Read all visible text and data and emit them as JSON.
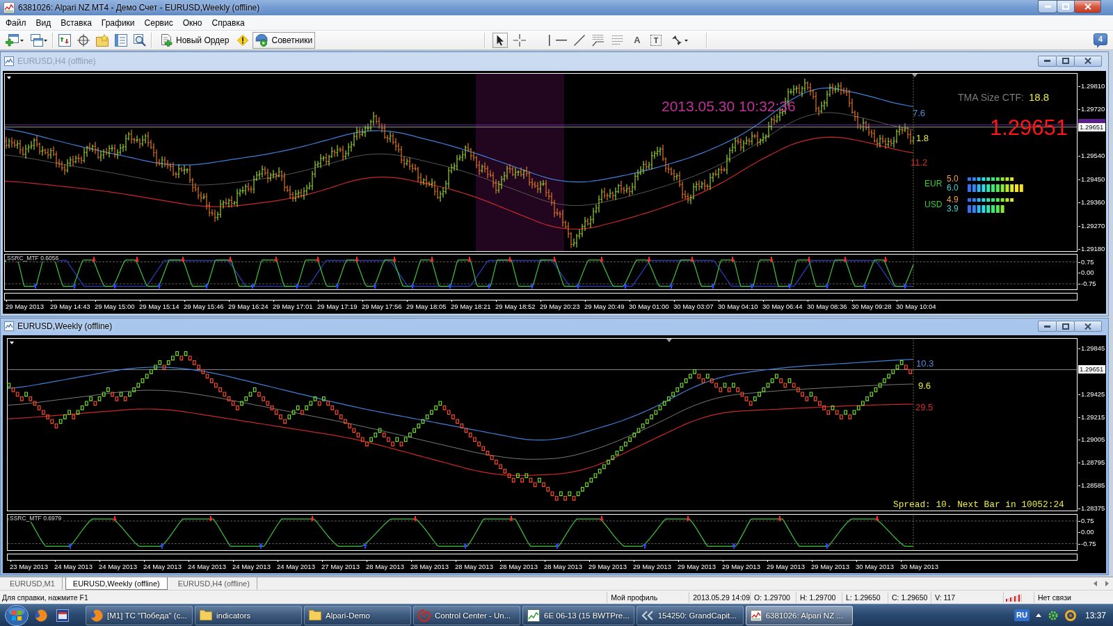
{
  "window": {
    "title": "6381026: Alpari NZ MT4 - Демо Счет - EURUSD,Weekly (offline)"
  },
  "menu": [
    "Файл",
    "Вид",
    "Вставка",
    "Графики",
    "Сервис",
    "Окно",
    "Справка"
  ],
  "toolbar": {
    "new_order": "Новый Ордер",
    "experts": {
      "label": "Советники",
      "selected": true
    },
    "cursor_tool": {
      "selected": true
    },
    "text_tool": "A",
    "label_tool": "T",
    "messages": "4"
  },
  "charts": [
    {
      "kind": "bars",
      "title": "EURUSD,H4 (offline)",
      "active": false,
      "server_time": "2013.05.30 10:32:36",
      "tma_size": {
        "label": "TMA Size CTF:",
        "value": "18.8"
      },
      "big_price": "1.29651",
      "band_labels": {
        "upper": "7.6",
        "middle": "1.8",
        "lower": "11.2"
      },
      "currency_strength": [
        {
          "currency": "EUR",
          "rows": [
            {
              "reading": "5.0"
            },
            {
              "reading": "6.0"
            }
          ]
        },
        {
          "currency": "USD",
          "rows": [
            {
              "reading": "4.9"
            },
            {
              "reading": "3.9"
            }
          ]
        }
      ],
      "price_axis": [
        "1.29810",
        "1.29720",
        "1.29540",
        "1.29450",
        "1.29360",
        "1.29270",
        "1.29180"
      ],
      "current_price": "1.29651",
      "indicator": {
        "label": "SSRC_MTF 0.6056",
        "axis": [
          "0.75",
          "0.00",
          "-0.75"
        ]
      },
      "time_axis": [
        "29 May 2013",
        "29 May 14:43",
        "29 May 15:00",
        "29 May 15:14",
        "29 May 15:46",
        "29 May 16:24",
        "29 May 17:01",
        "29 May 17:19",
        "29 May 17:56",
        "29 May 18:05",
        "29 May 18:21",
        "29 May 18:52",
        "29 May 20:23",
        "29 May 20:49",
        "30 May 01:00",
        "30 May 03:07",
        "30 May 04:10",
        "30 May 06:44",
        "30 May 08:36",
        "30 May 09:28",
        "30 May 10:04"
      ]
    },
    {
      "kind": "renko",
      "title": "EURUSD,Weekly (offline)",
      "active": true,
      "band_labels": {
        "upper": "10.3",
        "middle": "9.6",
        "lower": "29.5"
      },
      "spread_info": "Spread: 10. Next Bar in 10052:24",
      "price_axis": [
        "1.29845",
        "1.29425",
        "1.29215",
        "1.29005",
        "1.28795",
        "1.28585",
        "1.28375"
      ],
      "current_price": "1.29651",
      "indicator": {
        "label": "SSRC_MTF 0.6979",
        "axis": [
          "0.75",
          "0.00",
          "-0.75"
        ]
      },
      "time_axis": [
        "23 May 2013",
        "24 May 2013",
        "24 May 2013",
        "24 May 2013",
        "24 May 2013",
        "24 May 2013",
        "24 May 2013",
        "27 May 2013",
        "28 May 2013",
        "28 May 2013",
        "28 May 2013",
        "28 May 2013",
        "28 May 2013",
        "29 May 2013",
        "29 May 2013",
        "29 May 2013",
        "29 May 2013",
        "29 May 2013",
        "29 May 2013",
        "30 May 2013",
        "30 May 2013"
      ]
    }
  ],
  "tabs": [
    {
      "label": "EURUSD,M1",
      "selected": false
    },
    {
      "label": "EURUSD,Weekly (offline)",
      "selected": true
    },
    {
      "label": "EURUSD,H4 (offline)",
      "selected": false
    }
  ],
  "status_bar": {
    "help": "Для справки, нажмите F1",
    "profile": "Мой профиль",
    "time": "2013.05.29 14:09",
    "open": "O: 1.29700",
    "high": "H: 1.29700",
    "low": "L: 1.29650",
    "close": "C: 1.29650",
    "volume": "V: 117",
    "connection": "Нет связи"
  },
  "taskbar": {
    "tasks": [
      {
        "kind": "browser",
        "label": "[M1] ТС \"Победа\" (с...",
        "selected": false
      },
      {
        "kind": "folder",
        "label": "indicators",
        "selected": false
      },
      {
        "kind": "folder",
        "label": "Alpari-Demo",
        "selected": false
      },
      {
        "kind": "remote",
        "label": "Control Center - Un...",
        "selected": false
      },
      {
        "kind": "chart",
        "label": "6E 06-13 (15 BWTPre...",
        "selected": false
      },
      {
        "kind": "exchange",
        "label": "154250: GrandCapit...",
        "selected": false
      },
      {
        "kind": "terminal",
        "label": "6381026: Alpari NZ ...",
        "selected": true
      }
    ],
    "language": "RU",
    "clock": "13:37"
  }
}
